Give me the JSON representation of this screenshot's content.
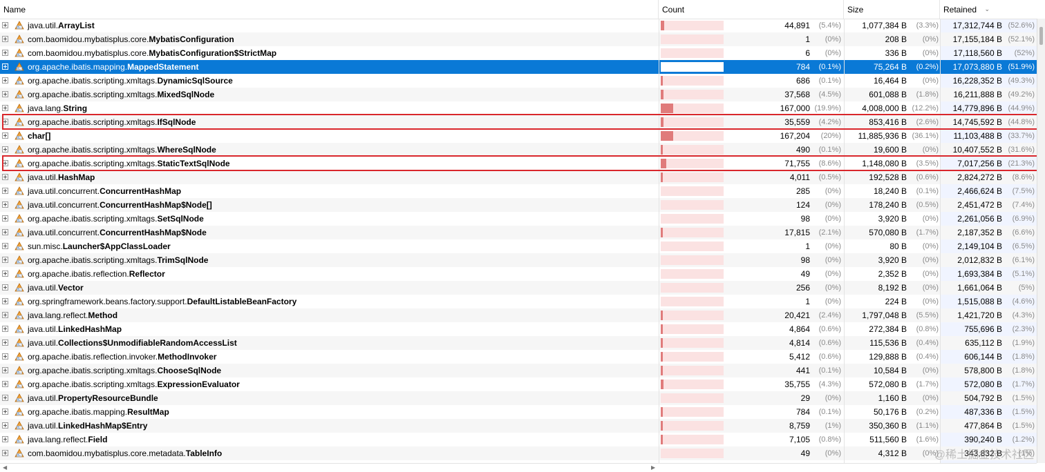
{
  "columns": {
    "name": "Name",
    "count": "Count",
    "size": "Size",
    "retained": "Retained"
  },
  "rows": [
    {
      "pkg": "java.util.",
      "cls": "ArrayList",
      "bar": 0.05,
      "count": "44,891",
      "count_pct": "(5.4%)",
      "size": "1,077,384 B",
      "size_pct": "(3.3%)",
      "retained": "17,312,744 B",
      "retained_pct": "(52.6%)"
    },
    {
      "pkg": "com.baomidou.mybatisplus.core.",
      "cls": "MybatisConfiguration",
      "bar": 0,
      "count": "1",
      "count_pct": "(0%)",
      "size": "208 B",
      "size_pct": "(0%)",
      "retained": "17,155,184 B",
      "retained_pct": "(52.1%)"
    },
    {
      "pkg": "com.baomidou.mybatisplus.core.",
      "cls": "MybatisConfiguration$StrictMap",
      "bar": 0,
      "count": "6",
      "count_pct": "(0%)",
      "size": "336 B",
      "size_pct": "(0%)",
      "retained": "17,118,560 B",
      "retained_pct": "(52%)"
    },
    {
      "pkg": "org.apache.ibatis.mapping.",
      "cls": "MappedStatement",
      "bar": 0.01,
      "count": "784",
      "count_pct": "(0.1%)",
      "size": "75,264 B",
      "size_pct": "(0.2%)",
      "retained": "17,073,880 B",
      "retained_pct": "(51.9%)",
      "selected": true
    },
    {
      "pkg": "org.apache.ibatis.scripting.xmltags.",
      "cls": "DynamicSqlSource",
      "bar": 0.01,
      "count": "686",
      "count_pct": "(0.1%)",
      "size": "16,464 B",
      "size_pct": "(0%)",
      "retained": "16,228,352 B",
      "retained_pct": "(49.3%)"
    },
    {
      "pkg": "org.apache.ibatis.scripting.xmltags.",
      "cls": "MixedSqlNode",
      "bar": 0.04,
      "count": "37,568",
      "count_pct": "(4.5%)",
      "size": "601,088 B",
      "size_pct": "(1.8%)",
      "retained": "16,211,888 B",
      "retained_pct": "(49.2%)"
    },
    {
      "pkg": "java.lang.",
      "cls": "String",
      "bar": 0.2,
      "count": "167,000",
      "count_pct": "(19.9%)",
      "size": "4,008,000 B",
      "size_pct": "(12.2%)",
      "retained": "14,779,896 B",
      "retained_pct": "(44.9%)"
    },
    {
      "pkg": "org.apache.ibatis.scripting.xmltags.",
      "cls": "IfSqlNode",
      "bar": 0.04,
      "count": "35,559",
      "count_pct": "(4.2%)",
      "size": "853,416 B",
      "size_pct": "(2.6%)",
      "retained": "14,745,592 B",
      "retained_pct": "(44.8%)",
      "highlight": true
    },
    {
      "pkg": "",
      "cls": "char[]",
      "bar": 0.2,
      "count": "167,204",
      "count_pct": "(20%)",
      "size": "11,885,936 B",
      "size_pct": "(36.1%)",
      "retained": "11,103,488 B",
      "retained_pct": "(33.7%)"
    },
    {
      "pkg": "org.apache.ibatis.scripting.xmltags.",
      "cls": "WhereSqlNode",
      "bar": 0.01,
      "count": "490",
      "count_pct": "(0.1%)",
      "size": "19,600 B",
      "size_pct": "(0%)",
      "retained": "10,407,552 B",
      "retained_pct": "(31.6%)"
    },
    {
      "pkg": "org.apache.ibatis.scripting.xmltags.",
      "cls": "StaticTextSqlNode",
      "bar": 0.086,
      "count": "71,755",
      "count_pct": "(8.6%)",
      "size": "1,148,080 B",
      "size_pct": "(3.5%)",
      "retained": "7,017,256 B",
      "retained_pct": "(21.3%)",
      "highlight": true
    },
    {
      "pkg": "java.util.",
      "cls": "HashMap",
      "bar": 0.005,
      "count": "4,011",
      "count_pct": "(0.5%)",
      "size": "192,528 B",
      "size_pct": "(0.6%)",
      "retained": "2,824,272 B",
      "retained_pct": "(8.6%)"
    },
    {
      "pkg": "java.util.concurrent.",
      "cls": "ConcurrentHashMap",
      "bar": 0,
      "count": "285",
      "count_pct": "(0%)",
      "size": "18,240 B",
      "size_pct": "(0.1%)",
      "retained": "2,466,624 B",
      "retained_pct": "(7.5%)"
    },
    {
      "pkg": "java.util.concurrent.",
      "cls": "ConcurrentHashMap$Node[]",
      "bar": 0,
      "count": "124",
      "count_pct": "(0%)",
      "size": "178,240 B",
      "size_pct": "(0.5%)",
      "retained": "2,451,472 B",
      "retained_pct": "(7.4%)"
    },
    {
      "pkg": "org.apache.ibatis.scripting.xmltags.",
      "cls": "SetSqlNode",
      "bar": 0,
      "count": "98",
      "count_pct": "(0%)",
      "size": "3,920 B",
      "size_pct": "(0%)",
      "retained": "2,261,056 B",
      "retained_pct": "(6.9%)"
    },
    {
      "pkg": "java.util.concurrent.",
      "cls": "ConcurrentHashMap$Node",
      "bar": 0.021,
      "count": "17,815",
      "count_pct": "(2.1%)",
      "size": "570,080 B",
      "size_pct": "(1.7%)",
      "retained": "2,187,352 B",
      "retained_pct": "(6.6%)"
    },
    {
      "pkg": "sun.misc.",
      "cls": "Launcher$AppClassLoader",
      "bar": 0,
      "count": "1",
      "count_pct": "(0%)",
      "size": "80 B",
      "size_pct": "(0%)",
      "retained": "2,149,104 B",
      "retained_pct": "(6.5%)"
    },
    {
      "pkg": "org.apache.ibatis.scripting.xmltags.",
      "cls": "TrimSqlNode",
      "bar": 0,
      "count": "98",
      "count_pct": "(0%)",
      "size": "3,920 B",
      "size_pct": "(0%)",
      "retained": "2,012,832 B",
      "retained_pct": "(6.1%)"
    },
    {
      "pkg": "org.apache.ibatis.reflection.",
      "cls": "Reflector",
      "bar": 0,
      "count": "49",
      "count_pct": "(0%)",
      "size": "2,352 B",
      "size_pct": "(0%)",
      "retained": "1,693,384 B",
      "retained_pct": "(5.1%)"
    },
    {
      "pkg": "java.util.",
      "cls": "Vector",
      "bar": 0,
      "count": "256",
      "count_pct": "(0%)",
      "size": "8,192 B",
      "size_pct": "(0%)",
      "retained": "1,661,064 B",
      "retained_pct": "(5%)"
    },
    {
      "pkg": "org.springframework.beans.factory.support.",
      "cls": "DefaultListableBeanFactory",
      "bar": 0,
      "count": "1",
      "count_pct": "(0%)",
      "size": "224 B",
      "size_pct": "(0%)",
      "retained": "1,515,088 B",
      "retained_pct": "(4.6%)"
    },
    {
      "pkg": "java.lang.reflect.",
      "cls": "Method",
      "bar": 0.024,
      "count": "20,421",
      "count_pct": "(2.4%)",
      "size": "1,797,048 B",
      "size_pct": "(5.5%)",
      "retained": "1,421,720 B",
      "retained_pct": "(4.3%)"
    },
    {
      "pkg": "java.util.",
      "cls": "LinkedHashMap",
      "bar": 0.006,
      "count": "4,864",
      "count_pct": "(0.6%)",
      "size": "272,384 B",
      "size_pct": "(0.8%)",
      "retained": "755,696 B",
      "retained_pct": "(2.3%)"
    },
    {
      "pkg": "java.util.",
      "cls": "Collections$UnmodifiableRandomAccessList",
      "bar": 0.006,
      "count": "4,814",
      "count_pct": "(0.6%)",
      "size": "115,536 B",
      "size_pct": "(0.4%)",
      "retained": "635,112 B",
      "retained_pct": "(1.9%)"
    },
    {
      "pkg": "org.apache.ibatis.reflection.invoker.",
      "cls": "MethodInvoker",
      "bar": 0.006,
      "count": "5,412",
      "count_pct": "(0.6%)",
      "size": "129,888 B",
      "size_pct": "(0.4%)",
      "retained": "606,144 B",
      "retained_pct": "(1.8%)"
    },
    {
      "pkg": "org.apache.ibatis.scripting.xmltags.",
      "cls": "ChooseSqlNode",
      "bar": 0.001,
      "count": "441",
      "count_pct": "(0.1%)",
      "size": "10,584 B",
      "size_pct": "(0%)",
      "retained": "578,800 B",
      "retained_pct": "(1.8%)"
    },
    {
      "pkg": "org.apache.ibatis.scripting.xmltags.",
      "cls": "ExpressionEvaluator",
      "bar": 0.043,
      "count": "35,755",
      "count_pct": "(4.3%)",
      "size": "572,080 B",
      "size_pct": "(1.7%)",
      "retained": "572,080 B",
      "retained_pct": "(1.7%)"
    },
    {
      "pkg": "java.util.",
      "cls": "PropertyResourceBundle",
      "bar": 0,
      "count": "29",
      "count_pct": "(0%)",
      "size": "1,160 B",
      "size_pct": "(0%)",
      "retained": "504,792 B",
      "retained_pct": "(1.5%)"
    },
    {
      "pkg": "org.apache.ibatis.mapping.",
      "cls": "ResultMap",
      "bar": 0.001,
      "count": "784",
      "count_pct": "(0.1%)",
      "size": "50,176 B",
      "size_pct": "(0.2%)",
      "retained": "487,336 B",
      "retained_pct": "(1.5%)"
    },
    {
      "pkg": "java.util.",
      "cls": "LinkedHashMap$Entry",
      "bar": 0.01,
      "count": "8,759",
      "count_pct": "(1%)",
      "size": "350,360 B",
      "size_pct": "(1.1%)",
      "retained": "477,864 B",
      "retained_pct": "(1.5%)"
    },
    {
      "pkg": "java.lang.reflect.",
      "cls": "Field",
      "bar": 0.008,
      "count": "7,105",
      "count_pct": "(0.8%)",
      "size": "511,560 B",
      "size_pct": "(1.6%)",
      "retained": "390,240 B",
      "retained_pct": "(1.2%)"
    },
    {
      "pkg": "com.baomidou.mybatisplus.core.metadata.",
      "cls": "TableInfo",
      "bar": 0,
      "count": "49",
      "count_pct": "(0%)",
      "size": "4,312 B",
      "size_pct": "(0%)",
      "retained": "343,832 B",
      "retained_pct": "(1%)"
    }
  ],
  "watermark": "@稀土掘金技术社区",
  "colors": {
    "selected_row": "#0a79d6",
    "highlight_box": "#d9262b",
    "bar_fill": "#e07b7b",
    "bar_track": "#fbe2e2"
  }
}
